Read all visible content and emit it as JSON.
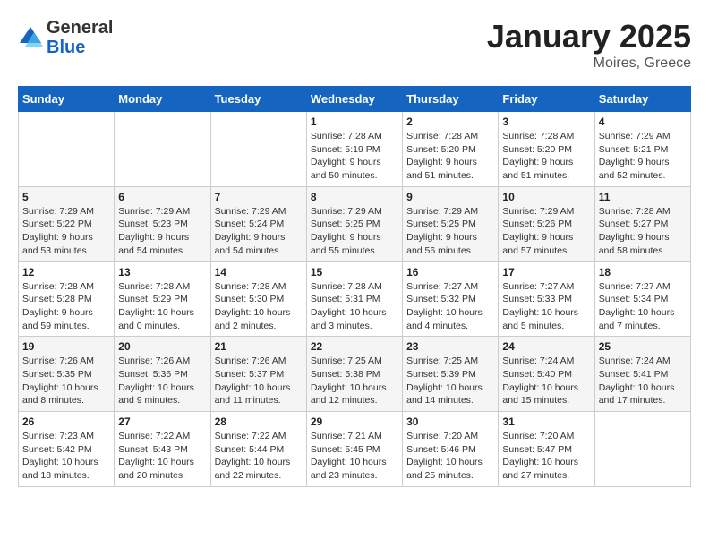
{
  "logo": {
    "general": "General",
    "blue": "Blue"
  },
  "header": {
    "title": "January 2025",
    "subtitle": "Moires, Greece"
  },
  "weekdays": [
    "Sunday",
    "Monday",
    "Tuesday",
    "Wednesday",
    "Thursday",
    "Friday",
    "Saturday"
  ],
  "weeks": [
    [
      {
        "day": "",
        "info": ""
      },
      {
        "day": "",
        "info": ""
      },
      {
        "day": "",
        "info": ""
      },
      {
        "day": "1",
        "info": "Sunrise: 7:28 AM\nSunset: 5:19 PM\nDaylight: 9 hours\nand 50 minutes."
      },
      {
        "day": "2",
        "info": "Sunrise: 7:28 AM\nSunset: 5:20 PM\nDaylight: 9 hours\nand 51 minutes."
      },
      {
        "day": "3",
        "info": "Sunrise: 7:28 AM\nSunset: 5:20 PM\nDaylight: 9 hours\nand 51 minutes."
      },
      {
        "day": "4",
        "info": "Sunrise: 7:29 AM\nSunset: 5:21 PM\nDaylight: 9 hours\nand 52 minutes."
      }
    ],
    [
      {
        "day": "5",
        "info": "Sunrise: 7:29 AM\nSunset: 5:22 PM\nDaylight: 9 hours\nand 53 minutes."
      },
      {
        "day": "6",
        "info": "Sunrise: 7:29 AM\nSunset: 5:23 PM\nDaylight: 9 hours\nand 54 minutes."
      },
      {
        "day": "7",
        "info": "Sunrise: 7:29 AM\nSunset: 5:24 PM\nDaylight: 9 hours\nand 54 minutes."
      },
      {
        "day": "8",
        "info": "Sunrise: 7:29 AM\nSunset: 5:25 PM\nDaylight: 9 hours\nand 55 minutes."
      },
      {
        "day": "9",
        "info": "Sunrise: 7:29 AM\nSunset: 5:25 PM\nDaylight: 9 hours\nand 56 minutes."
      },
      {
        "day": "10",
        "info": "Sunrise: 7:29 AM\nSunset: 5:26 PM\nDaylight: 9 hours\nand 57 minutes."
      },
      {
        "day": "11",
        "info": "Sunrise: 7:28 AM\nSunset: 5:27 PM\nDaylight: 9 hours\nand 58 minutes."
      }
    ],
    [
      {
        "day": "12",
        "info": "Sunrise: 7:28 AM\nSunset: 5:28 PM\nDaylight: 9 hours\nand 59 minutes."
      },
      {
        "day": "13",
        "info": "Sunrise: 7:28 AM\nSunset: 5:29 PM\nDaylight: 10 hours\nand 0 minutes."
      },
      {
        "day": "14",
        "info": "Sunrise: 7:28 AM\nSunset: 5:30 PM\nDaylight: 10 hours\nand 2 minutes."
      },
      {
        "day": "15",
        "info": "Sunrise: 7:28 AM\nSunset: 5:31 PM\nDaylight: 10 hours\nand 3 minutes."
      },
      {
        "day": "16",
        "info": "Sunrise: 7:27 AM\nSunset: 5:32 PM\nDaylight: 10 hours\nand 4 minutes."
      },
      {
        "day": "17",
        "info": "Sunrise: 7:27 AM\nSunset: 5:33 PM\nDaylight: 10 hours\nand 5 minutes."
      },
      {
        "day": "18",
        "info": "Sunrise: 7:27 AM\nSunset: 5:34 PM\nDaylight: 10 hours\nand 7 minutes."
      }
    ],
    [
      {
        "day": "19",
        "info": "Sunrise: 7:26 AM\nSunset: 5:35 PM\nDaylight: 10 hours\nand 8 minutes."
      },
      {
        "day": "20",
        "info": "Sunrise: 7:26 AM\nSunset: 5:36 PM\nDaylight: 10 hours\nand 9 minutes."
      },
      {
        "day": "21",
        "info": "Sunrise: 7:26 AM\nSunset: 5:37 PM\nDaylight: 10 hours\nand 11 minutes."
      },
      {
        "day": "22",
        "info": "Sunrise: 7:25 AM\nSunset: 5:38 PM\nDaylight: 10 hours\nand 12 minutes."
      },
      {
        "day": "23",
        "info": "Sunrise: 7:25 AM\nSunset: 5:39 PM\nDaylight: 10 hours\nand 14 minutes."
      },
      {
        "day": "24",
        "info": "Sunrise: 7:24 AM\nSunset: 5:40 PM\nDaylight: 10 hours\nand 15 minutes."
      },
      {
        "day": "25",
        "info": "Sunrise: 7:24 AM\nSunset: 5:41 PM\nDaylight: 10 hours\nand 17 minutes."
      }
    ],
    [
      {
        "day": "26",
        "info": "Sunrise: 7:23 AM\nSunset: 5:42 PM\nDaylight: 10 hours\nand 18 minutes."
      },
      {
        "day": "27",
        "info": "Sunrise: 7:22 AM\nSunset: 5:43 PM\nDaylight: 10 hours\nand 20 minutes."
      },
      {
        "day": "28",
        "info": "Sunrise: 7:22 AM\nSunset: 5:44 PM\nDaylight: 10 hours\nand 22 minutes."
      },
      {
        "day": "29",
        "info": "Sunrise: 7:21 AM\nSunset: 5:45 PM\nDaylight: 10 hours\nand 23 minutes."
      },
      {
        "day": "30",
        "info": "Sunrise: 7:20 AM\nSunset: 5:46 PM\nDaylight: 10 hours\nand 25 minutes."
      },
      {
        "day": "31",
        "info": "Sunrise: 7:20 AM\nSunset: 5:47 PM\nDaylight: 10 hours\nand 27 minutes."
      },
      {
        "day": "",
        "info": ""
      }
    ]
  ]
}
